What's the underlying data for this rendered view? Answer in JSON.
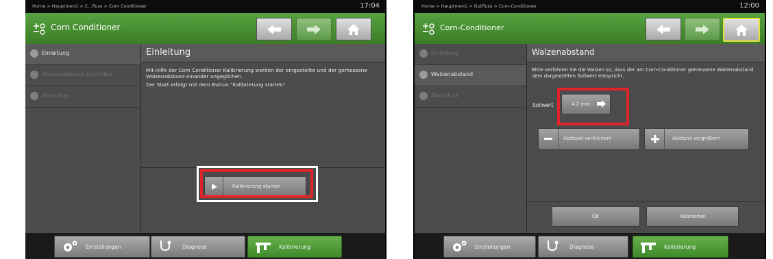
{
  "colors": {
    "accent": "#4e9a36",
    "highlight": "#e0242c"
  },
  "left": {
    "breadcrumb": "Home > Hauptmenü > C...fluss > Corn Conditioner",
    "clock": "17:04",
    "title": "Corn Conditioner",
    "nav": {
      "back_icon": "arrow-left-icon",
      "forward_icon": "arrow-right-icon",
      "home_icon": "home-icon"
    },
    "steps": [
      {
        "label": "Einleitung",
        "state": "active"
      },
      {
        "label": "Walzenabstand einstellen",
        "state": "inactive"
      },
      {
        "label": "Abschluss",
        "state": "inactive"
      }
    ],
    "heading": "Einleitung",
    "paragraph1": "Mit Hilfe der Corn Conditioner Kalibrierung werden der eingestellte und der gemessene Walzenabstand einander angeglichen.",
    "paragraph2": "Der Start erfolgt mit dem Button \"Kalibrierung starten\".",
    "start_button": "Kalibrierung starten",
    "tabs": [
      {
        "label": "Einstellungen",
        "icon": "gears-icon",
        "active": false
      },
      {
        "label": "Diagnose",
        "icon": "stethoscope-icon",
        "active": false
      },
      {
        "label": "Kalibrierung",
        "icon": "caliper-icon",
        "active": true
      }
    ]
  },
  "right": {
    "breadcrumb": "Home > Hauptmenü > Gutfluss > Corn-Conditioner",
    "clock": "12:00",
    "title": "Corn-Conditioner",
    "steps": [
      {
        "label": "Einleitung",
        "state": "done"
      },
      {
        "label": "Walzenabstand",
        "state": "active"
      },
      {
        "label": "Abschluss",
        "state": "inactive"
      }
    ],
    "heading": "Walzenabstand",
    "paragraph": "Bitte verfahren Sie die Walzen so, dass der am Corn-Conditioner gemessene Walzenabstand dem dargestellten Sollwert entspricht.",
    "target_label": "Sollwert",
    "target_value": "4.2 mm",
    "decrease_button": "Abstand verkleinern",
    "increase_button": "Abstand vergrößern",
    "ok_button": "OK",
    "cancel_button": "Abbrechen",
    "tabs": [
      {
        "label": "Einstellungen",
        "icon": "gears-icon",
        "active": false
      },
      {
        "label": "Diagnose",
        "icon": "stethoscope-icon",
        "active": false
      },
      {
        "label": "Kalibrierung",
        "icon": "caliper-icon",
        "active": true
      }
    ]
  }
}
